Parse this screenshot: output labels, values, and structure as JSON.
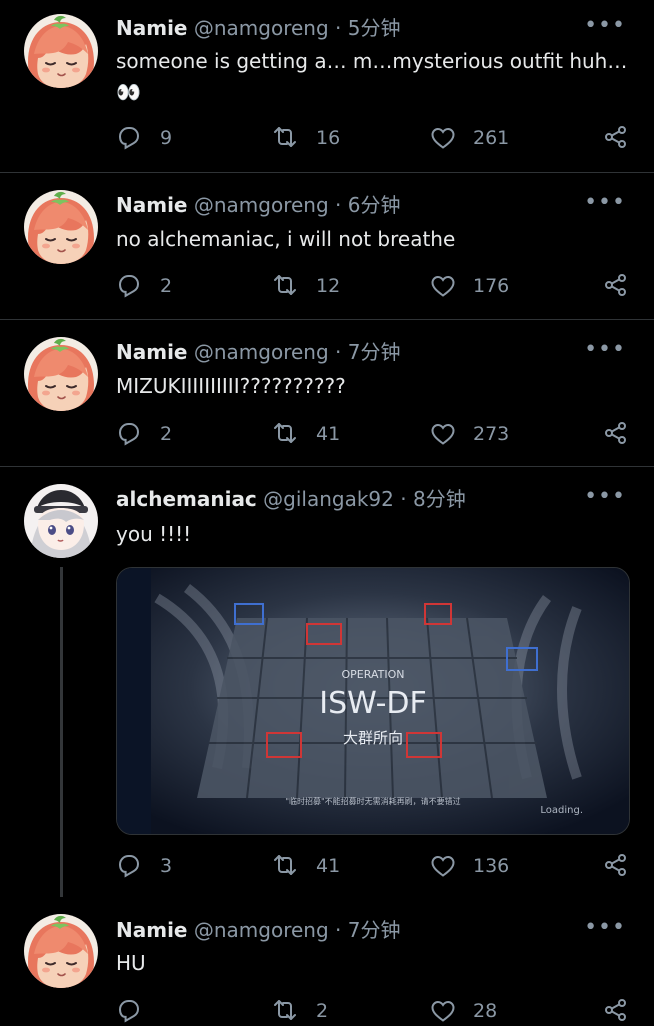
{
  "tweets": [
    {
      "name": "Namie",
      "handle": "@namgoreng",
      "time": "5分钟",
      "text": "someone is getting a… m…mysterious outfit huh…",
      "text2": "👀",
      "reply": "9",
      "retweet": "16",
      "like": "261"
    },
    {
      "name": "Namie",
      "handle": "@namgoreng",
      "time": "6分钟",
      "text": "no alchemaniac, i will not breathe",
      "reply": "2",
      "retweet": "12",
      "like": "176"
    },
    {
      "name": "Namie",
      "handle": "@namgoreng",
      "time": "7分钟",
      "text": "MIZUKIIIIIIIIII??????????",
      "reply": "2",
      "retweet": "41",
      "like": "273"
    },
    {
      "name": "alchemaniac",
      "handle": "@gilangak92",
      "time": "8分钟",
      "text": "you !!!!",
      "reply": "3",
      "retweet": "41",
      "like": "136",
      "media": {
        "operation": "OPERATION",
        "code": "ISW-DF",
        "title": "大群所向",
        "loading": "Loading.",
        "tip": "\"临时招募\"不能招募时无需消耗再刷，请不要错过"
      }
    },
    {
      "name": "Namie",
      "handle": "@namgoreng",
      "time": "7分钟",
      "text": "HU",
      "reply": "",
      "retweet": "2",
      "like": "28"
    }
  ],
  "icons": {
    "reply": "reply-icon",
    "retweet": "retweet-icon",
    "like": "heart-icon",
    "share": "share-icon",
    "more": "more-icon"
  },
  "colors": {
    "background": "#000000",
    "muted": "#8b98a5",
    "text": "#e7e9ea",
    "divider": "#2f3336"
  }
}
